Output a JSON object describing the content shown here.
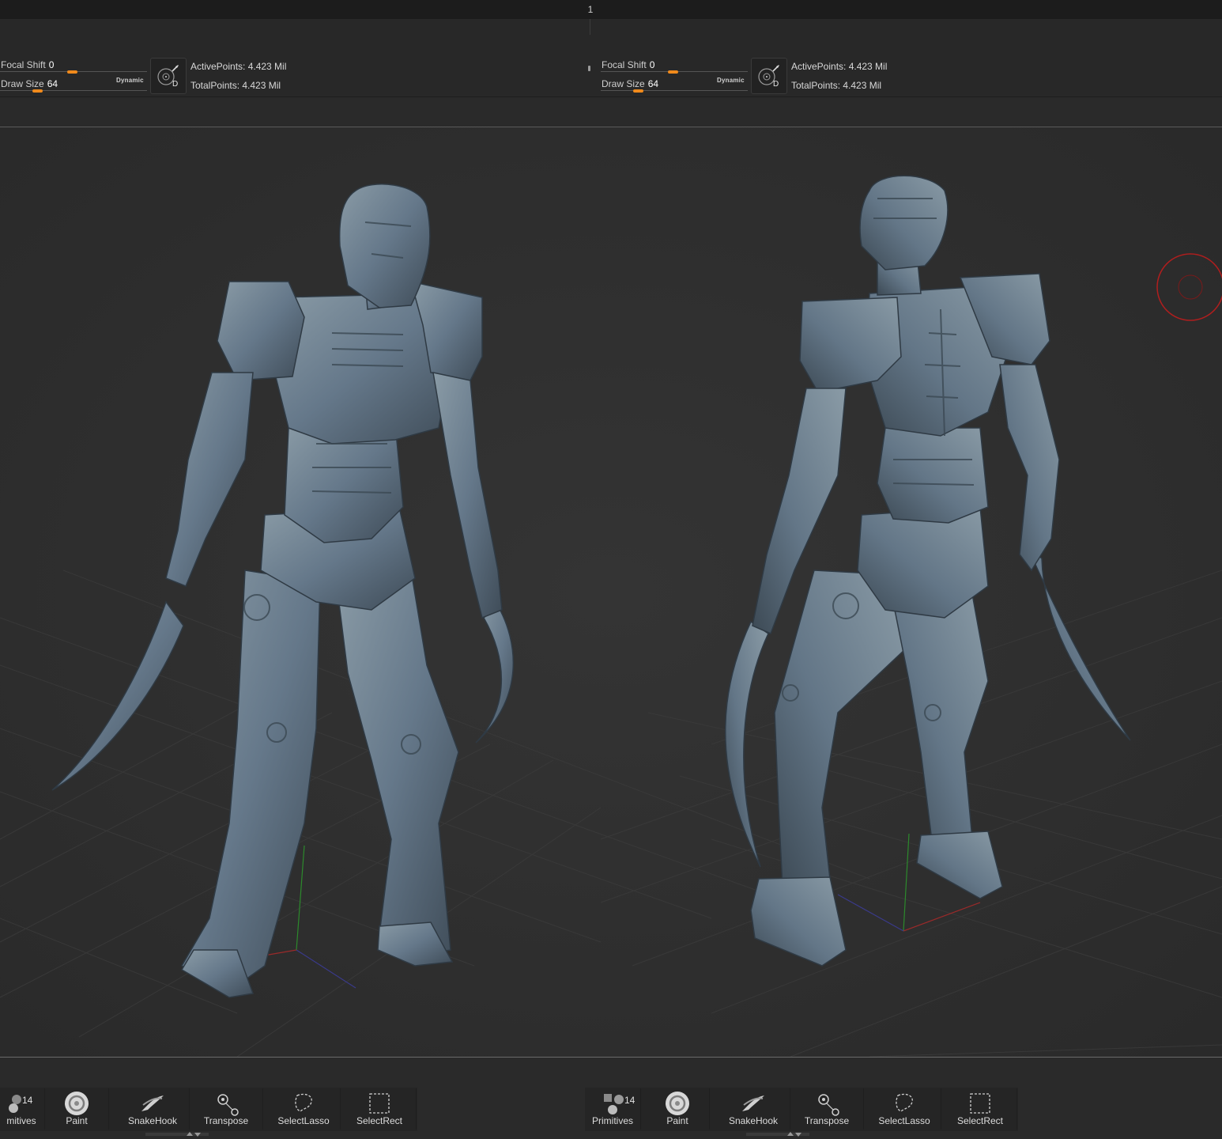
{
  "window": {
    "page_number": "1"
  },
  "left_panel": {
    "focal_shift_label": "Focal Shift",
    "focal_shift_value": "0",
    "draw_size_label": "Draw Size",
    "draw_size_value": "64",
    "dynamic_label": "Dynamic",
    "lazy_mouse_icon": "lazymouse-icon",
    "lazy_mouse_letter": "D",
    "active_points": "ActivePoints: 4.423 Mil",
    "total_points": "TotalPoints: 4.423 Mil",
    "tools": [
      {
        "name": "mitives",
        "count": "14",
        "icon": "primitives-icon"
      },
      {
        "name": "Paint",
        "icon": "paint-icon"
      },
      {
        "name": "SnakeHook",
        "icon": "snakehook-icon"
      },
      {
        "name": "Transpose",
        "icon": "transpose-icon"
      },
      {
        "name": "SelectLasso",
        "icon": "selectlasso-icon"
      },
      {
        "name": "SelectRect",
        "icon": "selectrect-icon"
      }
    ]
  },
  "right_panel": {
    "focal_shift_label": "Focal Shift",
    "focal_shift_value": "0",
    "draw_size_label": "Draw Size",
    "draw_size_value": "64",
    "dynamic_label": "Dynamic",
    "lazy_mouse_icon": "lazymouse-icon",
    "lazy_mouse_letter": "D",
    "active_points": "ActivePoints: 4.423 Mil",
    "total_points": "TotalPoints: 4.423 Mil",
    "tools": [
      {
        "name": "Primitives",
        "count": "14",
        "icon": "primitives-icon"
      },
      {
        "name": "Paint",
        "icon": "paint-icon"
      },
      {
        "name": "SnakeHook",
        "icon": "snakehook-icon"
      },
      {
        "name": "Transpose",
        "icon": "transpose-icon"
      },
      {
        "name": "SelectLasso",
        "icon": "selectlasso-icon"
      },
      {
        "name": "SelectRect",
        "icon": "selectrect-icon"
      }
    ]
  },
  "colors": {
    "slider_knob": "#f08a1c",
    "model_clay": "#6c7f8c",
    "brush_cursor": "#b01e1e",
    "background": "#2e2e2e"
  }
}
